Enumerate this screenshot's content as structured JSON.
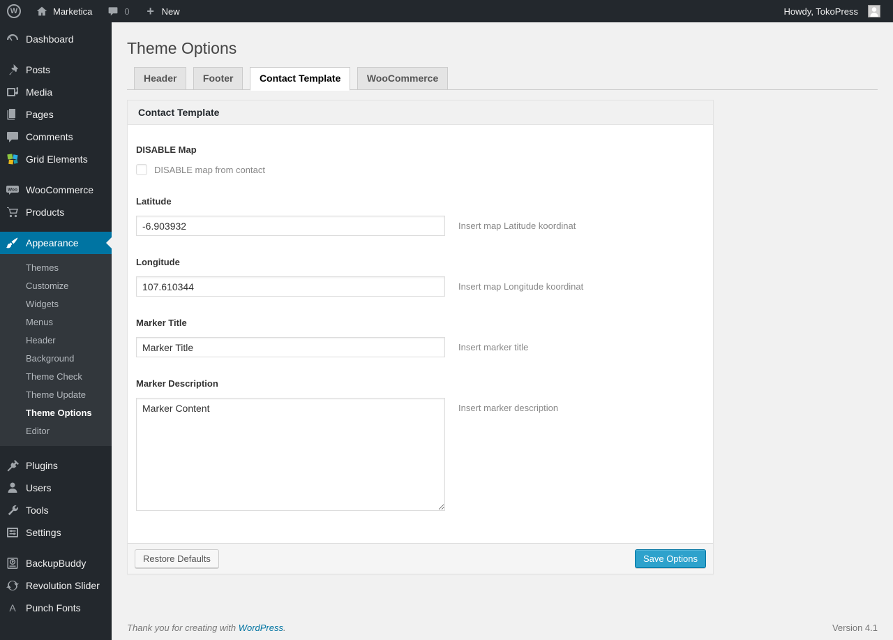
{
  "admin_bar": {
    "logo_glyph": "W",
    "site_name": "Marketica",
    "comment_count": "0",
    "plus_glyph": "+",
    "new_label": "New",
    "howdy": "Howdy, TokoPress"
  },
  "sidebar": {
    "items": [
      {
        "label": "Dashboard"
      },
      {
        "label": "Posts"
      },
      {
        "label": "Media"
      },
      {
        "label": "Pages"
      },
      {
        "label": "Comments"
      },
      {
        "label": "Grid Elements"
      },
      {
        "label": "WooCommerce"
      },
      {
        "label": "Products"
      },
      {
        "label": "Appearance"
      },
      {
        "label": "Plugins"
      },
      {
        "label": "Users"
      },
      {
        "label": "Tools"
      },
      {
        "label": "Settings"
      },
      {
        "label": "BackupBuddy"
      },
      {
        "label": "Revolution Slider"
      },
      {
        "label": "Punch Fonts"
      }
    ],
    "appearance_submenu": [
      "Themes",
      "Customize",
      "Widgets",
      "Menus",
      "Header",
      "Background",
      "Theme Check",
      "Theme Update",
      "Theme Options",
      "Editor"
    ],
    "woo_glyph": "Woo",
    "punch_fonts_glyph": "A"
  },
  "main": {
    "page_title": "Theme Options",
    "tabs": [
      {
        "label": "Header"
      },
      {
        "label": "Footer"
      },
      {
        "label": "Contact Template"
      },
      {
        "label": "WooCommerce"
      }
    ],
    "panel": {
      "title": "Contact Template",
      "fields": {
        "disable_map": {
          "label": "DISABLE Map",
          "checkbox_label": "DISABLE map from contact",
          "checked": false
        },
        "latitude": {
          "label": "Latitude",
          "value": "-6.903932",
          "help": "Insert map Latitude koordinat"
        },
        "longitude": {
          "label": "Longitude",
          "value": "107.610344",
          "help": "Insert map Longitude koordinat"
        },
        "marker_title": {
          "label": "Marker Title",
          "value": "Marker Title",
          "help": "Insert marker title"
        },
        "marker_description": {
          "label": "Marker Description",
          "value": "Marker Content",
          "help": "Insert marker description"
        }
      },
      "restore_button": "Restore Defaults",
      "save_button": "Save Options"
    }
  },
  "footer": {
    "thanks_prefix": "Thank you for creating with ",
    "wordpress_link": "WordPress",
    "thanks_suffix": ".",
    "version": "Version 4.1"
  },
  "colors": {
    "menu_highlight": "#0074a2",
    "button_primary": "#2ea2cc",
    "button_primary_border": "#0074a2",
    "admin_bar_bg": "#23282d",
    "submenu_bg": "#32373c",
    "page_bg": "#f1f1f1"
  }
}
